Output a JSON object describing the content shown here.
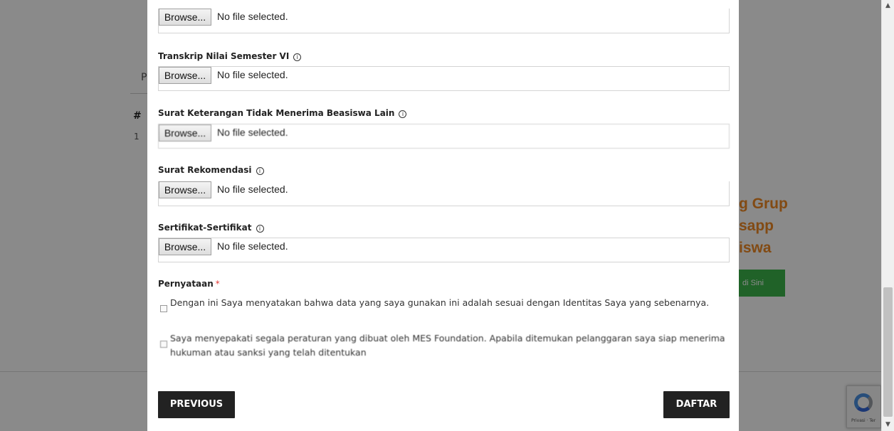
{
  "background": {
    "left_letter": "P",
    "table_hash": "#",
    "table_row_one": "1",
    "promo_lines": [
      "g Grup",
      "sapp",
      "iswa"
    ],
    "promo_button_label": "di Sini",
    "recaptcha_text": "Privasi · Ter"
  },
  "form": {
    "fields": [
      {
        "label": "",
        "browse_label": "Browse...",
        "status": "No file selected."
      },
      {
        "label": "Transkrip Nilai Semester VI",
        "browse_label": "Browse...",
        "status": "No file selected."
      },
      {
        "label": "Surat Keterangan Tidak Menerima Beasiswa Lain",
        "browse_label": "Browse...",
        "status": "No file selected."
      },
      {
        "label": "Surat Rekomendasi",
        "browse_label": "Browse...",
        "status": "No file selected."
      },
      {
        "label": "Sertifikat-Sertifikat",
        "browse_label": "Browse...",
        "status": "No file selected."
      }
    ],
    "info_glyph": "i",
    "pernyataan": {
      "label": "Pernyataan",
      "required_mark": "*",
      "statements": [
        "Dengan ini Saya menyatakan bahwa data yang saya gunakan ini adalah sesuai dengan Identitas Saya yang sebenarnya.",
        "Saya menyepakati segala peraturan yang dibuat oleh MES Foundation. Apabila ditemukan pelanggaran saya siap menerima hukuman atau sanksi yang telah ditentukan"
      ]
    },
    "buttons": {
      "previous": "PREVIOUS",
      "submit": "DAFTAR"
    }
  },
  "colors": {
    "overlay": "rgba(0,0,0,0.46)",
    "button_dark": "#222222",
    "promo_orange": "#f08a24",
    "promo_green": "#3cb54a",
    "required_red": "#e53935"
  },
  "icons": {
    "info": "info-circle-icon",
    "scroll_up": "chevron-up-icon",
    "scroll_down": "chevron-down-icon",
    "recaptcha": "recaptcha-logo-icon"
  }
}
